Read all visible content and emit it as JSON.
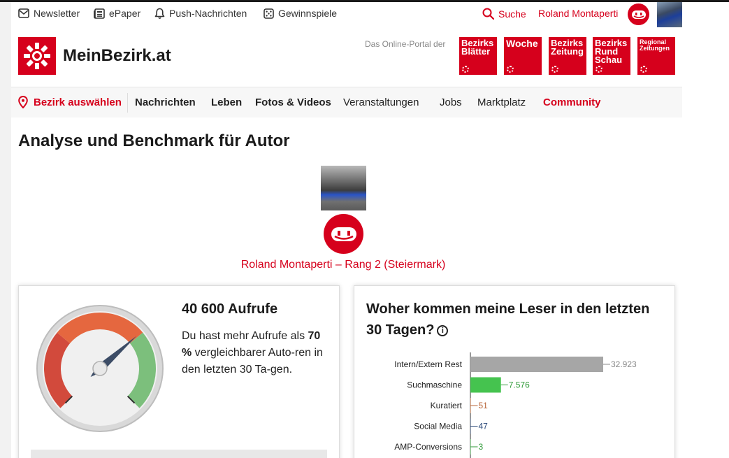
{
  "utility": {
    "newsletter": "Newsletter",
    "epaper": "ePaper",
    "push": "Push-Nachrichten",
    "gewinnspiele": "Gewinnspiele",
    "search": "Suche",
    "user": "Roland Montaperti"
  },
  "brand": {
    "name": "MeinBezirk.at",
    "portal_label": "Das Online-Portal der",
    "papers": [
      [
        "Bezirks",
        "Blätter"
      ],
      [
        "Woche"
      ],
      [
        "Bezirks",
        "Zeitung"
      ],
      [
        "Bezirks",
        "Rund",
        "Schau"
      ],
      [
        "Regional",
        "Zeitungen"
      ]
    ]
  },
  "nav": {
    "bezirk": "Bezirk auswählen",
    "items": [
      "Nachrichten",
      "Leben",
      "Fotos & Videos",
      "Veranstaltungen",
      "Jobs",
      "Marktplatz",
      "Community"
    ]
  },
  "page": {
    "title": "Analyse und Benchmark für Autor",
    "author_name": "Roland Montaperti",
    "separator": " – ",
    "rank": "Rang 2 (Steiermark)"
  },
  "views_card": {
    "title": "40 600 Aufrufe",
    "text_before": "Du hast mehr Aufrufe als ",
    "percent": "70 %",
    "text_after": " vergleichbarer Auto-ren in den letzten 30 Ta-gen.",
    "gauge_percent": 70
  },
  "readers_card": {
    "title": "Woher kommen meine Leser in den letzten 30 Tagen?",
    "info": "i"
  },
  "colors": {
    "brand_red": "#d6001c",
    "bar_grey": "#a6a6a6",
    "bar_green": "#45c34f"
  },
  "chart_data": {
    "type": "bar",
    "orientation": "horizontal",
    "categories": [
      "Intern/Extern Rest",
      "Suchmaschine",
      "Kuratiert",
      "Social Media",
      "AMP-Conversions"
    ],
    "values": [
      32923,
      7576,
      51,
      47,
      3
    ],
    "labels": [
      "32.923",
      "7.576",
      "51",
      "47",
      "3"
    ],
    "label_colors": [
      "#8a8a8a",
      "#2f9a38",
      "#b8653a",
      "#2c4a7a",
      "#2f9a38"
    ],
    "bar_colors": [
      "#a6a6a6",
      "#45c34f",
      "#e07a3a",
      "#2c4a7a",
      "#45c34f"
    ],
    "xlim": [
      0,
      32923
    ]
  }
}
